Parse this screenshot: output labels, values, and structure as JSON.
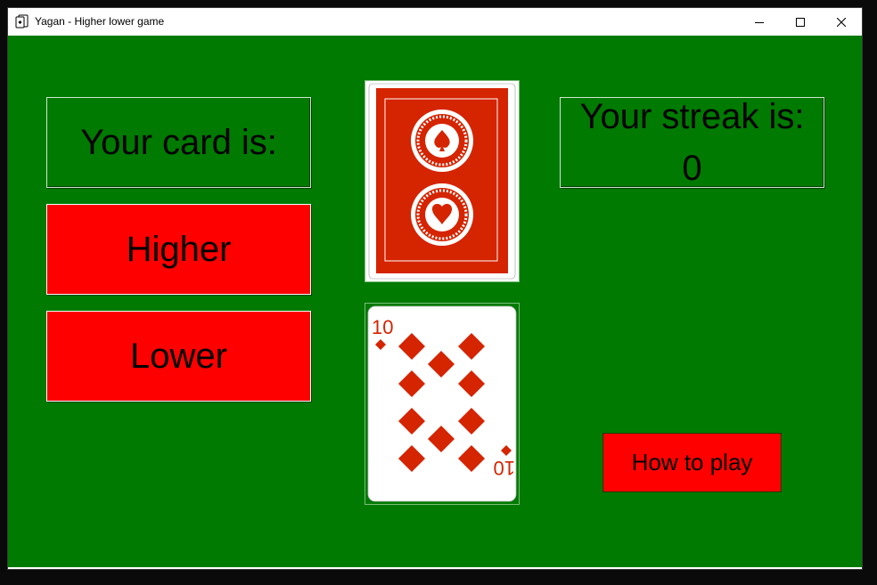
{
  "window": {
    "title": "Yagan - Higher lower game",
    "icon": "playing-card-icon",
    "controls": [
      "minimize-icon",
      "maximize-icon",
      "close-icon"
    ]
  },
  "game": {
    "your_card_label": "Your card is:",
    "higher_label": "Higher",
    "lower_label": "Lower",
    "streak_label": "Your streak is:",
    "streak_value": "0",
    "how_to_play_label": "How to play",
    "deck_card": "card-back",
    "current_card": {
      "rank": "10",
      "suit": "diamonds"
    }
  },
  "colors": {
    "table_green": "#007a00",
    "button_red": "#ff0000",
    "card_back_red": "#d42400",
    "suit_red": "#d42400"
  }
}
